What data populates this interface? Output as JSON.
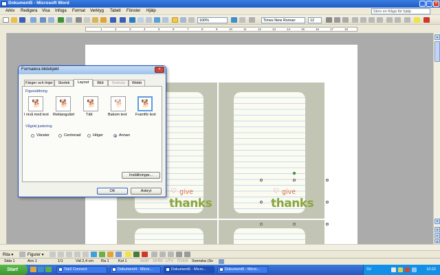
{
  "window": {
    "title": "Dokument5 - Microsoft Word",
    "controls": {
      "minimize": "_",
      "maximize": "□",
      "close": "×"
    }
  },
  "menu": {
    "items": [
      "Arkiv",
      "Redigera",
      "Visa",
      "Infoga",
      "Format",
      "Verktyg",
      "Tabell",
      "Fönster",
      "Hjälp"
    ],
    "help_placeholder": "Skriv en fråga för hjälp"
  },
  "toolbar": {
    "zoom": "100%",
    "font": "Times New Roman",
    "font_size": "12"
  },
  "ruler": {
    "numbers": [
      "1",
      "2",
      "3",
      "4",
      "5",
      "6",
      "7",
      "8",
      "9",
      "10",
      "11",
      "12",
      "13",
      "14",
      "15",
      "16",
      "17",
      "18"
    ]
  },
  "cards": {
    "give": "give",
    "thanks": "thanks",
    "heart": "♡"
  },
  "dialog": {
    "title": "Formatera bildobjekt",
    "close": "×",
    "tabs": [
      "Färger och linjer",
      "Storlek",
      "Layout",
      "Bild",
      "Textruta",
      "Webb"
    ],
    "active_tab": "Layout",
    "disabled_tab": "Textruta",
    "wrap_group": "Figursättning",
    "wrap_options": [
      "I nivå med text",
      "Rektangulärt",
      "Tätt",
      "Bakom text",
      "Framför text"
    ],
    "selected_wrap": "Framför text",
    "align_group": "Vågrät justering",
    "align_options": [
      "Vänster",
      "Centrerad",
      "Höger",
      "Annan"
    ],
    "selected_align": "Annan",
    "advanced_button": "Inställningar...",
    "ok_button": "OK",
    "cancel_button": "Avbryt"
  },
  "drawbar": {
    "draw": "Rita ▾",
    "figures": "Figurer ▾"
  },
  "status": {
    "page": "Sida 1",
    "section": "Avs 1",
    "pages": "1/1",
    "at": "Vid 2,4 cm",
    "line": "Ra 1",
    "col": "Kol 1",
    "modes": [
      "INSP",
      "SPÅR",
      "UTV",
      "ÖVER"
    ],
    "language": "Svenska (Sv"
  },
  "taskbar": {
    "start": "Start",
    "tasks": [
      "Tek2 Connect",
      "Dokument4 - Micro...",
      "Dokument5 - Micro...",
      "Dokument5 - Micro..."
    ],
    "tray_lang": "SV",
    "clock": "10:22"
  }
}
